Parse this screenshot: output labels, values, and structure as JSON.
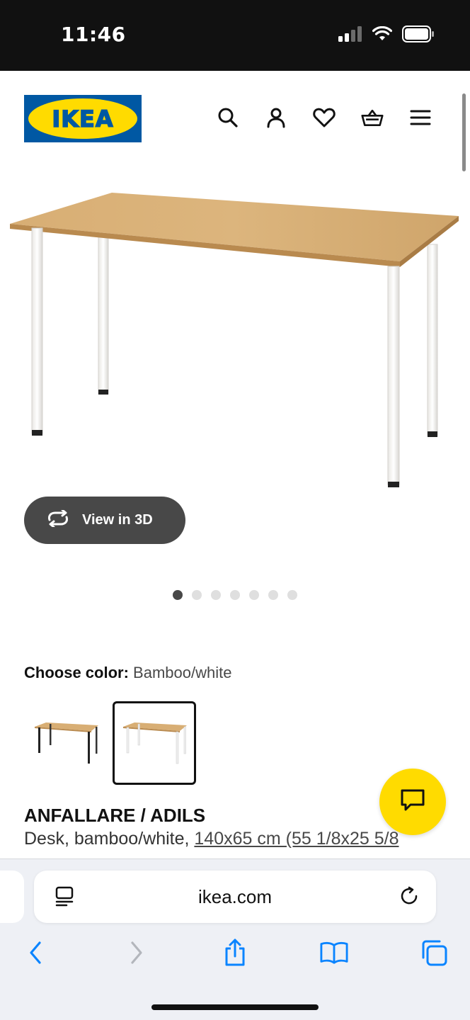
{
  "status_bar": {
    "time": "11:46"
  },
  "header": {
    "logo_text": "IKEA",
    "icons": [
      "search-icon",
      "account-icon",
      "heart-icon",
      "basket-icon",
      "menu-icon"
    ]
  },
  "product": {
    "view3d_label": "View in 3D",
    "image_count": 7,
    "active_image_index": 0,
    "choose_color_label": "Choose color:",
    "color_value": "Bamboo/white",
    "color_options": [
      "Bamboo/black",
      "Bamboo/white"
    ],
    "selected_color_index": 1,
    "name": "ANFALLARE / ADILS",
    "desc_prefix": "Desk, bamboo/white, ",
    "desc_size": "140x65 cm (55 1/8x25 5/8"
  },
  "browser": {
    "url": "ikea.com"
  },
  "colors": {
    "ikea_blue": "#0058a3",
    "ikea_yellow": "#ffdb00",
    "ios_blue": "#0a84ff"
  }
}
